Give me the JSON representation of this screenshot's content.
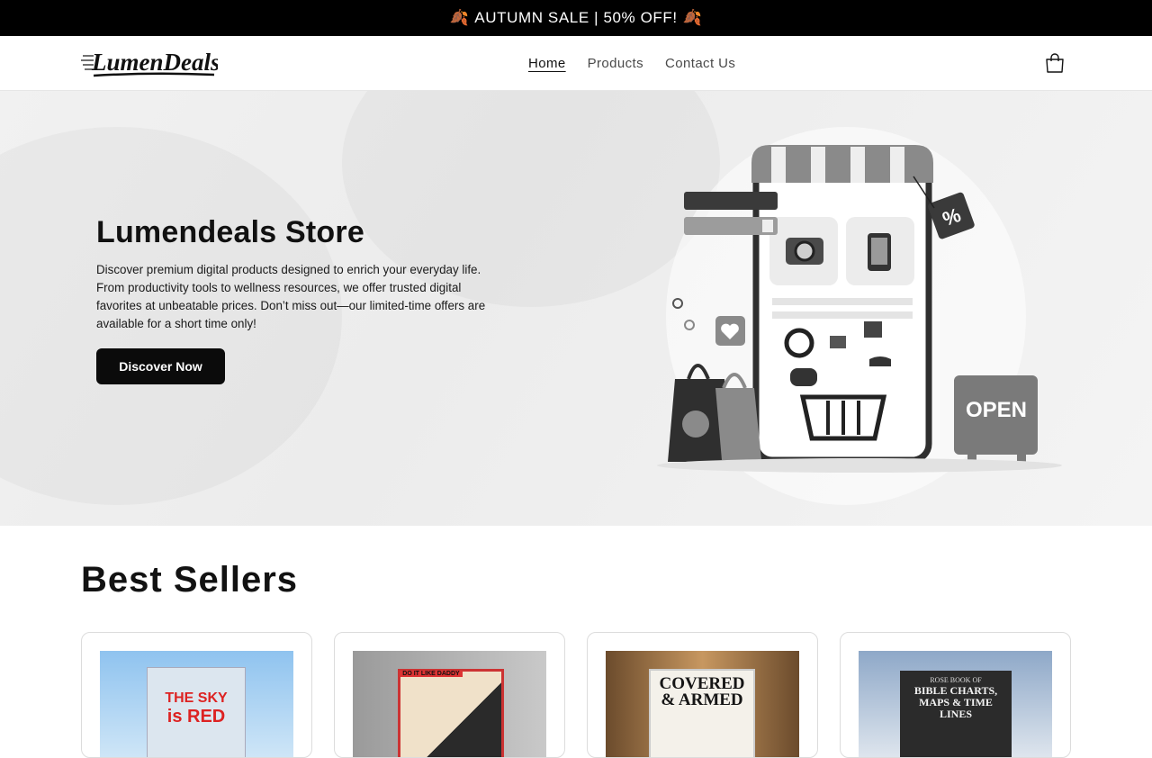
{
  "announcement": {
    "text": "AUTUMN SALE | 50% OFF!",
    "emoji": "🍂"
  },
  "header": {
    "logo_text": "LumenDeals",
    "nav": [
      {
        "label": "Home",
        "active": true
      },
      {
        "label": "Products",
        "active": false
      },
      {
        "label": "Contact Us",
        "active": false
      }
    ],
    "cart_icon": "cart-icon"
  },
  "hero": {
    "title": "Lumendeals  Store",
    "text": "Discover premium digital products designed to enrich your everyday life. From productivity tools to wellness resources, we offer trusted digital favorites at unbeatable prices. Don’t miss out—our limited-time offers are available for a short time only!",
    "button": "Discover Now",
    "open_sign": "OPEN",
    "tag": "%"
  },
  "best_sellers": {
    "heading": "Best Sellers",
    "products": [
      {
        "cover_line1": "THE SKY",
        "cover_line2": "is RED"
      },
      {
        "cover_line1": "DO IT LIKE DADDY",
        "cover_line2": ""
      },
      {
        "cover_line1": "COVERED",
        "cover_line2": "& ARMED"
      },
      {
        "cover_line1": "ROSE BOOK OF",
        "cover_line2": "BIBLE CHARTS, MAPS & TIME LINES"
      }
    ]
  },
  "colors": {
    "announcement_bg": "#000000",
    "leaf": "#b8632b",
    "button_bg": "#0b0b0b"
  }
}
